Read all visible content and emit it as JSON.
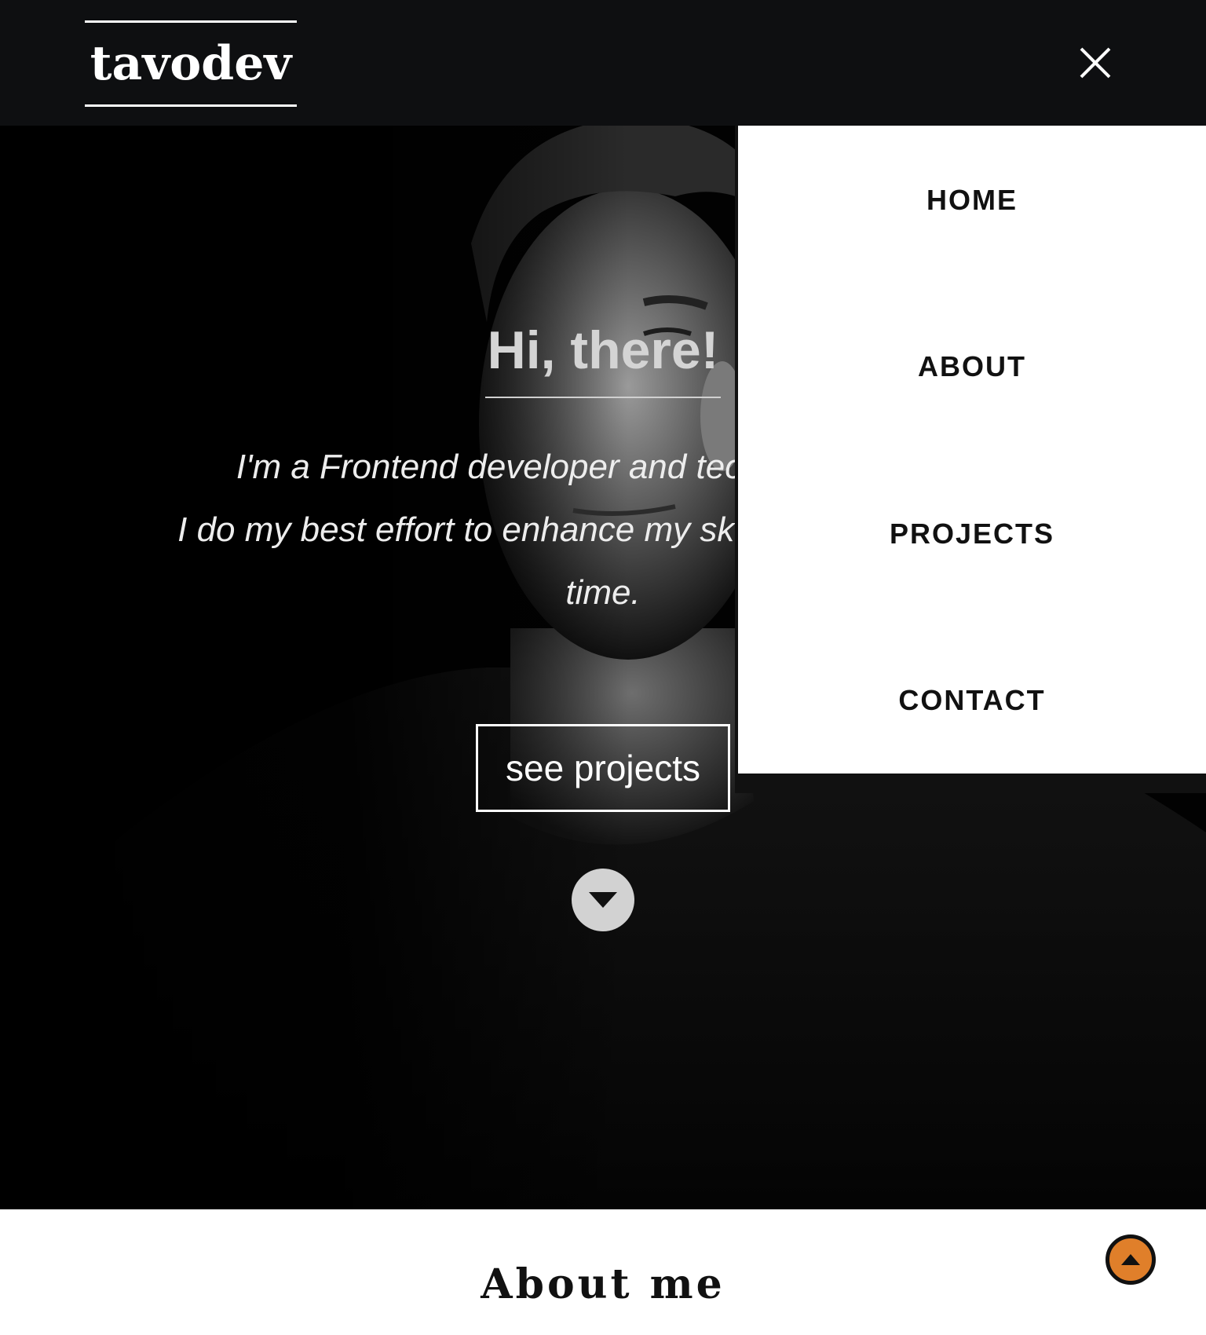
{
  "header": {
    "logo_text": "tavodev",
    "close_icon": "close-icon"
  },
  "nav": {
    "items": [
      {
        "label": "HOME"
      },
      {
        "label": "ABOUT"
      },
      {
        "label": "PROJECTS"
      },
      {
        "label": "CONTACT"
      }
    ]
  },
  "hero": {
    "title": "Hi, there!",
    "line1": "I'm a Frontend developer and tec",
    "line2": "I do my best effort to enhance my skills day",
    "line3": "time.",
    "cta_label": "see projects",
    "scroll_icon": "caret-down-icon"
  },
  "about": {
    "title": "About me",
    "back_to_top_icon": "caret-up-icon"
  },
  "colors": {
    "header_bg": "#0e0f11",
    "accent": "#e07f2a",
    "menu_bg": "#ffffff"
  }
}
